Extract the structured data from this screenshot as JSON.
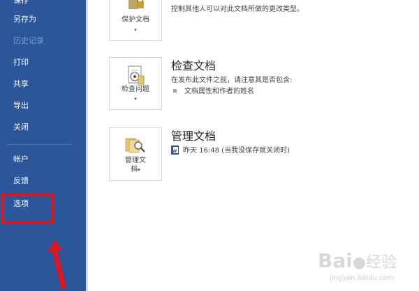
{
  "sidebar": {
    "items": [
      {
        "label": "保存"
      },
      {
        "label": "另存为"
      },
      {
        "label": "历史记录"
      },
      {
        "label": "打印"
      },
      {
        "label": "共享"
      },
      {
        "label": "导出"
      },
      {
        "label": "关闭"
      },
      {
        "label": "帐户"
      },
      {
        "label": "反馈"
      },
      {
        "label": "选项"
      }
    ]
  },
  "protect": {
    "button_label": "保护文档",
    "description": "控制其他人可以对此文档所做的更改类型。"
  },
  "inspect": {
    "title": "检查文档",
    "button_label": "检查问题",
    "description": "在发布此文件之前，请注意其是否包含:",
    "bullet": "文档属性和作者的姓名"
  },
  "manage": {
    "title": "管理文档",
    "button_line1": "管理文",
    "button_line2": "档",
    "version_entry": "昨天 16:48 (当我没保存就关闭时)"
  },
  "colors": {
    "sidebar": "#2b579a",
    "annotation": "#e4141c"
  },
  "watermark": {
    "brand": "Bai",
    "suffix": "经验",
    "url": "jingyan.baidu.com"
  }
}
